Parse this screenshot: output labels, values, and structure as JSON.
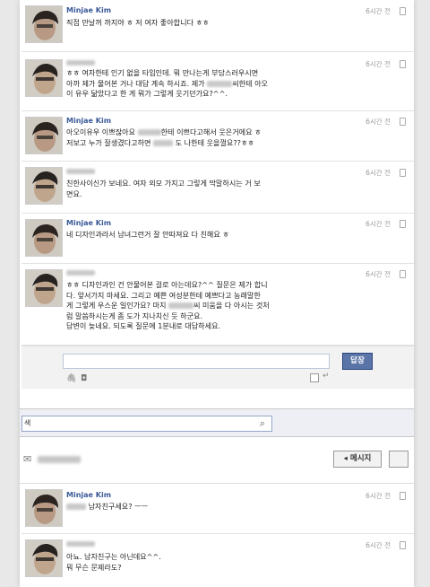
{
  "messages": [
    {
      "name": "Minjae Kim",
      "time": "6시간 전",
      "text": "직접 만날꺼 까지야 ㅎ 저 여자 좋아합니다 ㅎㅎ"
    },
    {
      "name": "",
      "time": "6시간 전",
      "text_a": "ㅎㅎ 여자한테 인기 없을 타입인데. 뭐 만나는게 부담스러우시면\n아까 제가 물어본 거나 대답 계속 하시죠. 제가 ",
      "text_b": "씨한테 아오\n이 유우 닮았다고 한 게 뭐가 그렇게 웃기던가요?^^."
    },
    {
      "name": "Minjae Kim",
      "time": "6시간 전",
      "text_a": "아오이유우 이쁘잖아요 ",
      "text_b": "한테 이쁘다고해서 웃은거에요 ㅎ\n저보고 누가 잘생겼다고하면 ",
      "text_c": "도 나한테 웃을껄요??ㅎㅎ"
    },
    {
      "name": "",
      "time": "6시간 전",
      "text": "친한사이신가 보네요. 여자 외모 가지고 그렇게 막말하시는 거 보\n면요."
    },
    {
      "name": "Minjae Kim",
      "time": "6시간 전",
      "text": "네 디자인과라서 남녀그런거 잘 안따져요 다 친해요 ㅎ"
    },
    {
      "name": "",
      "time": "6시간 전",
      "text_a": "ㅎㅎ 디자인과인 건 안물어본 걸로 아는데요?^^ 질문은 제가 합니\n다. 앞서가지 마세요. 그리고 예쁜 여성분한테 예쁘다고 농래말한\n게 그렇게 우스운 일인가요? 마치 ",
      "text_b": "씨 미움을 다 아시는 것처\n럼 말씀하시는게 좀 도가 지나치신 듯 하군요.\n답변이 늦네요. 되도록 질문에 1분내로 대답하세요."
    }
  ],
  "reply": {
    "button": "답장"
  },
  "search": {
    "value": "색"
  },
  "toolbar": {
    "message_button": "◂ 메시지"
  },
  "messages2": [
    {
      "name": "Minjae Kim",
      "time": "6시간 전",
      "text_b": "남자친구세요? ㅡㅡ"
    },
    {
      "name": "",
      "time": "6시간 전",
      "text": "아뇨. 남자친구는 아닌데요^^.\n뭐 무슨 문제라도?"
    }
  ]
}
